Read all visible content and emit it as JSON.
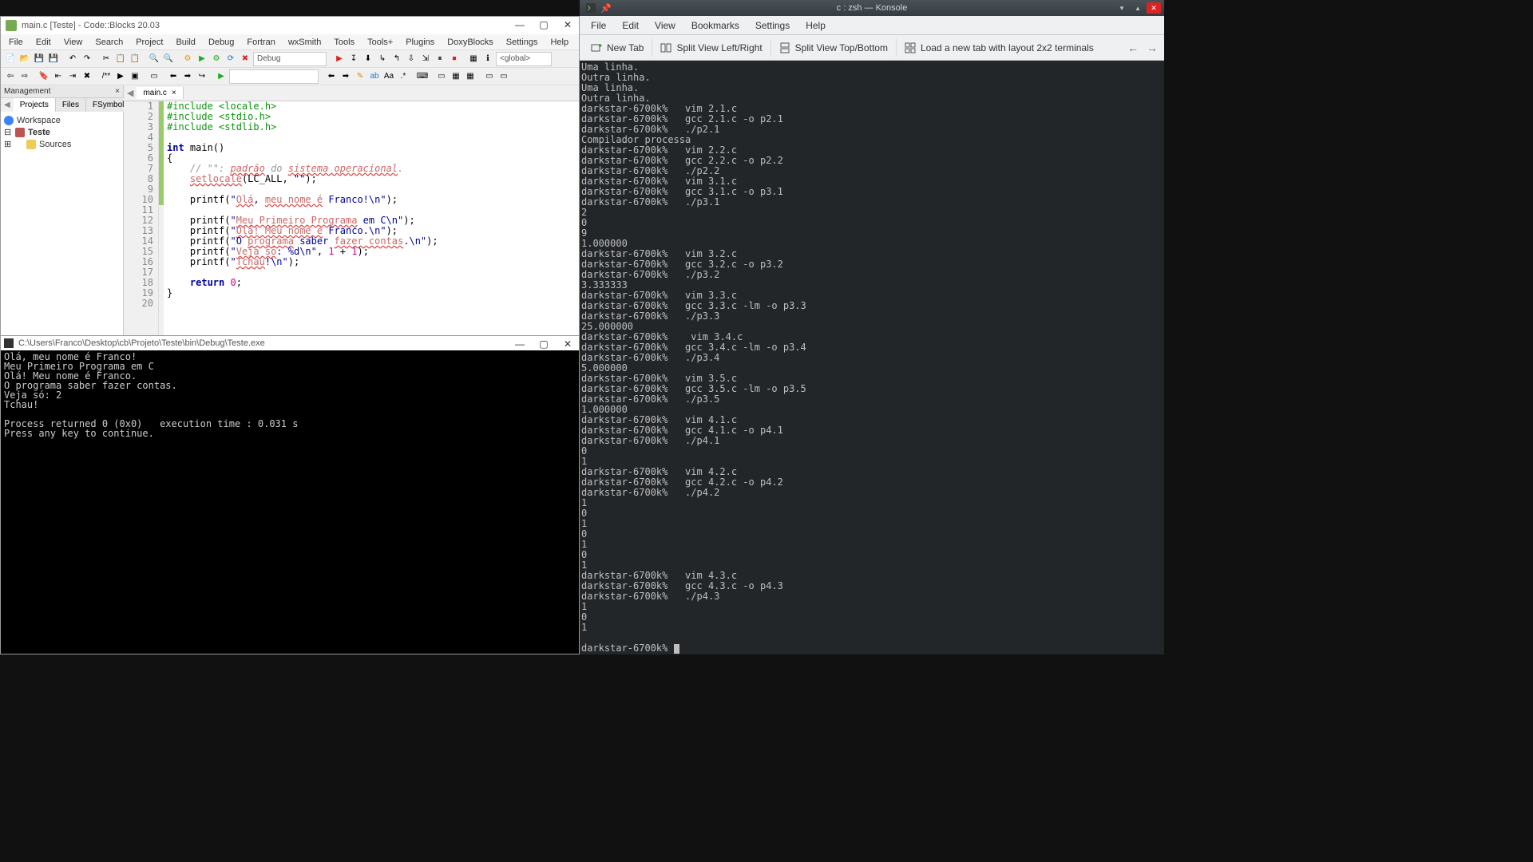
{
  "codeblocks": {
    "title": "main.c [Teste] - Code::Blocks 20.03",
    "menus": [
      "File",
      "Edit",
      "View",
      "Search",
      "Project",
      "Build",
      "Debug",
      "Fortran",
      "wxSmith",
      "Tools",
      "Tools+",
      "Plugins",
      "DoxyBlocks",
      "Settings",
      "Help"
    ],
    "toolbar_combo1": "Debug",
    "toolbar_combo2": "<global>",
    "management": {
      "title": "Management",
      "tabs": [
        "Projects",
        "Files",
        "FSymbols"
      ],
      "active_tab": 0,
      "tree": {
        "workspace": "Workspace",
        "project": "Teste",
        "folder": "Sources"
      }
    },
    "file_tab": "main.c",
    "code_lines": [
      {
        "n": 1,
        "chg": true,
        "html": "<span class='kw-pre'>#include &lt;locale.h&gt;</span>"
      },
      {
        "n": 2,
        "chg": true,
        "html": "<span class='kw-pre'>#include &lt;stdio.h&gt;</span>"
      },
      {
        "n": 3,
        "chg": true,
        "html": "<span class='kw-pre'>#include &lt;stdlib.h&gt;</span>"
      },
      {
        "n": 4,
        "chg": true,
        "html": ""
      },
      {
        "n": 5,
        "chg": true,
        "html": "<span class='kw-blue'>int</span> main()"
      },
      {
        "n": 6,
        "chg": true,
        "html": "{"
      },
      {
        "n": 7,
        "chg": true,
        "html": "    <span class='kw-cmt'>// \"\": </span><span class='kw-cmt kw-red'>padrão</span><span class='kw-cmt'> do </span><span class='kw-cmt kw-red'>sistema operacional</span><span class='kw-cmt'>.</span>"
      },
      {
        "n": 8,
        "chg": true,
        "html": "    <span class='kw-red'>setlocale</span>(LC_ALL, <span class='kw-str'>\"\"</span>);"
      },
      {
        "n": 9,
        "chg": true,
        "html": ""
      },
      {
        "n": 10,
        "chg": true,
        "html": "    printf(<span class='kw-str'>\"<span class='kw-red'>Olá</span>, <span class='kw-red'>meu nome é</span> Franco!\\n\"</span>);"
      },
      {
        "n": 11,
        "chg": false,
        "html": ""
      },
      {
        "n": 12,
        "chg": false,
        "html": "    printf(<span class='kw-str'>\"<span class='kw-red'>Meu Primeiro Programa</span> em C\\n\"</span>);"
      },
      {
        "n": 13,
        "chg": false,
        "html": "    printf(<span class='kw-str'>\"<span class='kw-red'>Olá! Meu nome é</span> Franco.\\n\"</span>);"
      },
      {
        "n": 14,
        "chg": false,
        "html": "    printf(<span class='kw-str'>\"O <span class='kw-red'>programa</span> saber <span class='kw-red'>fazer contas</span>.\\n\"</span>);"
      },
      {
        "n": 15,
        "chg": false,
        "html": "    printf(<span class='kw-str'>\"<span class='kw-red'>Veja só</span>: %d\\n\"</span>, <span class='kw-num'>1</span> + <span class='kw-num'>1</span>);"
      },
      {
        "n": 16,
        "chg": false,
        "html": "    printf(<span class='kw-str'>\"<span class='kw-red'>Tchau</span>!\\n\"</span>);"
      },
      {
        "n": 17,
        "chg": false,
        "html": ""
      },
      {
        "n": 18,
        "chg": false,
        "html": "    <span class='kw-blue'>return</span> <span class='kw-num'>0</span>;"
      },
      {
        "n": 19,
        "chg": false,
        "html": "}"
      },
      {
        "n": 20,
        "chg": false,
        "html": ""
      }
    ]
  },
  "console": {
    "title": "C:\\Users\\Franco\\Desktop\\cb\\Projeto\\Teste\\bin\\Debug\\Teste.exe",
    "output": "Olá, meu nome é Franco!\nMeu Primeiro Programa em C\nOlá! Meu nome é Franco.\nO programa saber fazer contas.\nVeja só: 2\nTchau!\n\nProcess returned 0 (0x0)   execution time : 0.031 s\nPress any key to continue."
  },
  "konsole": {
    "title": "c : zsh — Konsole",
    "menus": [
      "File",
      "Edit",
      "View",
      "Bookmarks",
      "Settings",
      "Help"
    ],
    "tabs": {
      "new_tab": "New Tab",
      "split_lr": "Split View Left/Right",
      "split_tb": "Split View Top/Bottom",
      "load_layout": "Load a new tab with layout 2x2 terminals"
    },
    "term": "Uma linha.\nOutra linha.\nUma linha.\nOutra linha.\ndarkstar-6700k%   vim 2.1.c\ndarkstar-6700k%   gcc 2.1.c -o p2.1\ndarkstar-6700k%   ./p2.1\nCompilador processa\ndarkstar-6700k%   vim 2.2.c\ndarkstar-6700k%   gcc 2.2.c -o p2.2\ndarkstar-6700k%   ./p2.2\ndarkstar-6700k%   vim 3.1.c\ndarkstar-6700k%   gcc 3.1.c -o p3.1\ndarkstar-6700k%   ./p3.1\n2\n0\n9\n1.000000\ndarkstar-6700k%   vim 3.2.c\ndarkstar-6700k%   gcc 3.2.c -o p3.2\ndarkstar-6700k%   ./p3.2\n3.333333\ndarkstar-6700k%   vim 3.3.c\ndarkstar-6700k%   gcc 3.3.c -lm -o p3.3\ndarkstar-6700k%   ./p3.3\n25.000000\ndarkstar-6700k%    vim 3.4.c\ndarkstar-6700k%   gcc 3.4.c -lm -o p3.4\ndarkstar-6700k%   ./p3.4\n5.000000\ndarkstar-6700k%   vim 3.5.c\ndarkstar-6700k%   gcc 3.5.c -lm -o p3.5\ndarkstar-6700k%   ./p3.5\n1.000000\ndarkstar-6700k%   vim 4.1.c\ndarkstar-6700k%   gcc 4.1.c -o p4.1\ndarkstar-6700k%   ./p4.1\n0\n1\ndarkstar-6700k%   vim 4.2.c\ndarkstar-6700k%   gcc 4.2.c -o p4.2\ndarkstar-6700k%   ./p4.2\n1\n0\n1\n0\n1\n0\n1\ndarkstar-6700k%   vim 4.3.c\ndarkstar-6700k%   gcc 4.3.c -o p4.3\ndarkstar-6700k%   ./p4.3\n1\n0\n1\n\ndarkstar-6700k% "
  }
}
